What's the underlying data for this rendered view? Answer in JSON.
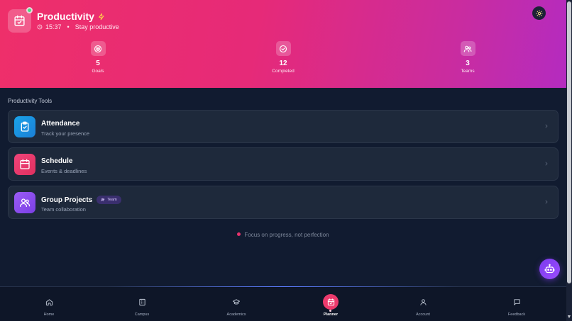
{
  "header": {
    "title": "Productivity",
    "time": "15:37",
    "separator": "•",
    "subtitle": "Stay productive",
    "stats": [
      {
        "value": "5",
        "label": "Goals",
        "icon": "target-icon"
      },
      {
        "value": "12",
        "label": "Completed",
        "icon": "check-circle-icon"
      },
      {
        "value": "3",
        "label": "Teams",
        "icon": "users-icon"
      }
    ]
  },
  "section": {
    "title": "Productivity Tools",
    "cards": [
      {
        "title": "Attendance",
        "subtitle": "Track your presence",
        "icon": "clipboard-check-icon",
        "color": "#1aa3e8"
      },
      {
        "title": "Schedule",
        "subtitle": "Events & deadlines",
        "icon": "calendar-icon",
        "color": "#ec3a6d"
      },
      {
        "title": "Group Projects",
        "subtitle": "Team collaboration",
        "badge": "Team",
        "icon": "users-icon",
        "color": "#8b4bf0"
      }
    ]
  },
  "tagline": "Focus on progress, not perfection",
  "nav": [
    {
      "label": "Home",
      "icon": "home-icon"
    },
    {
      "label": "Campus",
      "icon": "building-icon"
    },
    {
      "label": "Academics",
      "icon": "graduation-cap-icon"
    },
    {
      "label": "Planner",
      "icon": "calendar-check-icon",
      "active": true
    },
    {
      "label": "Account",
      "icon": "user-icon"
    },
    {
      "label": "Feedback",
      "icon": "message-icon"
    }
  ],
  "colors": {
    "accent": "#ec3a6d",
    "online": "#4ade80",
    "fab": "#7c3aed"
  }
}
